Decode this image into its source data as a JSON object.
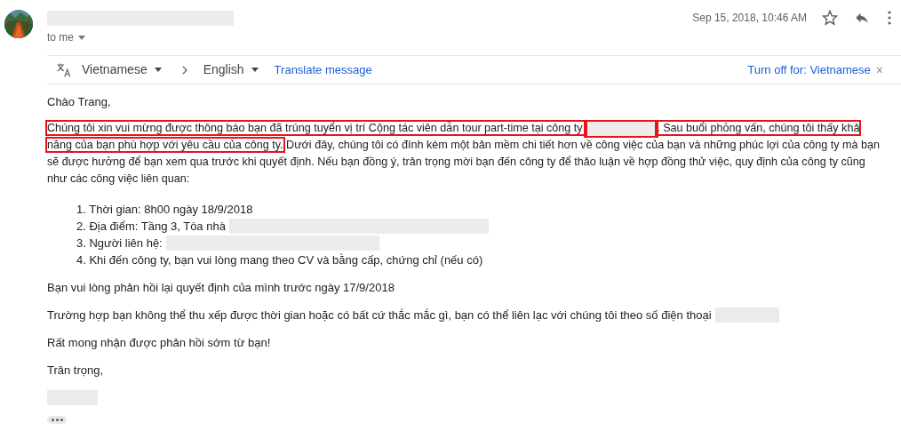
{
  "header": {
    "recipient": "to me",
    "date": "Sep 15, 2018, 10:46 AM"
  },
  "translate_bar": {
    "source_language": "Vietnamese",
    "target_language": "English",
    "translate_link": "Translate message",
    "turn_off_link": "Turn off for: Vietnamese",
    "close": "×"
  },
  "body": {
    "greeting": "Chào Trang,",
    "paragraph": [
      {
        "kind": "text",
        "text": "Chúng tôi xin vui mừng được thông báo bạn đã trúng tuyển vị trí Cộng tác viên dẫn tour part-time tại công ty ",
        "highlighted": true
      },
      {
        "kind": "redacted",
        "highlighted": true
      },
      {
        "kind": "text",
        "text": ". Sau buổi phỏng vấn, chúng tôi thấy khả năng của bạn phù hợp với yêu cầu của công ty.",
        "highlighted": true
      },
      {
        "kind": "text",
        "text": " Dưới đây, chúng tôi có đính kèm một bản mềm chi tiết hơn về công việc của bạn và những phúc lợi của công ty mà bạn sẽ được hưởng để bạn xem qua trước khi quyết định. Nếu bạn đồng ý, trân trọng mời bạn đến công ty để thảo luận về hợp đồng thử việc, quy định của công ty cũng như các công việc liên quan:",
        "highlighted": false
      }
    ],
    "list": [
      {
        "text": "1. Thời gian: 8h00  ngày 18/9/2018",
        "redacted": false
      },
      {
        "text": "2. Địa điểm: Tầng 3, Tòa nhà",
        "redacted": true
      },
      {
        "text": "3. Người liên hệ:",
        "redacted": true
      },
      {
        "text": "4. Khi đến công ty, bạn vui lòng mang theo CV và bằng cấp, chứng chỉ (nếu có)",
        "redacted": false
      }
    ],
    "paragraphs": [
      {
        "text": "Bạn vui lòng phản hồi lại quyết định của mình trước ngày 17/9/2018",
        "redacted": false
      },
      {
        "text": "Trường hợp bạn không thể thu xếp được thời gian hoặc có bất cứ thắc mắc gì, bạn có thể liên lạc với chúng tôi theo số điện thoại",
        "redacted": true
      },
      {
        "text": "Rất mong nhận được phản hồi sớm từ bạn!",
        "redacted": false
      },
      {
        "text": "Trân trọng,",
        "redacted": false
      }
    ],
    "signature_redacted": true
  }
}
